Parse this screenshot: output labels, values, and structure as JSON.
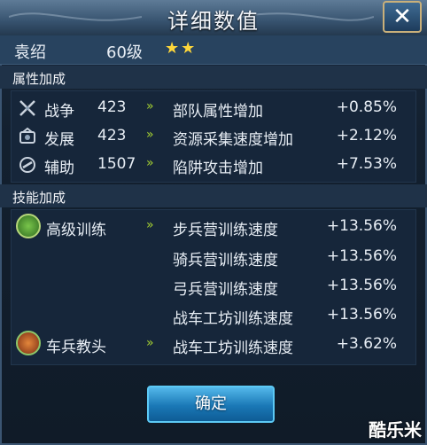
{
  "window": {
    "title": "详细数值"
  },
  "hero": {
    "name": "袁绍",
    "level": "60级",
    "stars": "★★"
  },
  "sections": {
    "attributes": "属性加成",
    "skills": "技能加成"
  },
  "attributes": [
    {
      "icon": "sword-icon",
      "label": "战争",
      "value": "423",
      "arrow": "»",
      "desc": "部队属性增加",
      "pct": "+0.85%"
    },
    {
      "icon": "development-icon",
      "label": "发展",
      "value": "423",
      "arrow": "»",
      "desc": "资源采集速度增加",
      "pct": "+2.12%"
    },
    {
      "icon": "support-icon",
      "label": "辅助",
      "value": "1507",
      "arrow": "»",
      "desc": "陷阱攻击增加",
      "pct": "+7.53%"
    }
  ],
  "skills": [
    {
      "name": "高级训练",
      "arrow": "»",
      "effects": [
        {
          "desc": "步兵营训练速度",
          "pct": "+13.56%"
        },
        {
          "desc": "骑兵营训练速度",
          "pct": "+13.56%"
        },
        {
          "desc": "弓兵营训练速度",
          "pct": "+13.56%"
        },
        {
          "desc": "战车工坊训练速度",
          "pct": "+13.56%"
        }
      ]
    },
    {
      "name": "车兵教头",
      "arrow": "»",
      "effects": [
        {
          "desc": "战车工坊训练速度",
          "pct": "+3.62%"
        }
      ]
    }
  ],
  "buttons": {
    "confirm": "确定",
    "close": "✕"
  },
  "watermark": "酷乐米",
  "colors": {
    "accent_green": "#a6d232",
    "star": "#ffd73a",
    "button_blue": "#1a78b6"
  }
}
